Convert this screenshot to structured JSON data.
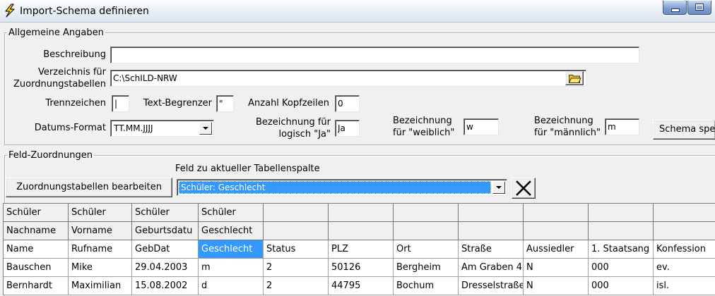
{
  "window": {
    "title": "Import-Schema definieren",
    "icon": "lightning-icon",
    "minimize_icon": "minimize-icon",
    "maximize_icon": "maximize-icon"
  },
  "colors": {
    "window_background": "#f0f0f0",
    "selection": "#3399ff",
    "titlebar_buttons": "#7e9fd0"
  },
  "general": {
    "legend": "Allgemeine Angaben",
    "description": {
      "label": "Beschreibung",
      "value": ""
    },
    "directory": {
      "label_line1": "Verzeichnis für",
      "label_line2": "Zuordnungstabellen",
      "value": "C:\\SchILD-NRW",
      "browse_icon": "folder-icon"
    },
    "separator": {
      "label": "Trennzeichen",
      "value": "|"
    },
    "text_delimiter": {
      "label": "Text-Begrenzer",
      "value": "\""
    },
    "header_rows": {
      "label": "Anzahl Kopfzeilen",
      "value": "0"
    },
    "date_format": {
      "label": "Datums-Format",
      "value": "TT.MM.JJJJ"
    },
    "logical_yes": {
      "label_line1": "Bezeichnung für",
      "label_line2": "logisch \"Ja\"",
      "value": "Ja"
    },
    "female": {
      "label_line1": "Bezeichnung",
      "label_line2": "für \"weiblich\"",
      "value": "w"
    },
    "male": {
      "label_line1": "Bezeichnung",
      "label_line2": "für \"männlich\"",
      "value": "m"
    },
    "save_schema_label": "Schema spe"
  },
  "mapping": {
    "legend": "Feld-Zuordnungen",
    "field_label": "Feld zu aktueller Tabellenspalte",
    "edit_tables_label": "Zuordnungstabellen bearbeiten",
    "field_select_value": "Schüler: Geschlecht",
    "clear_icon": "x-icon"
  },
  "grid": {
    "header_rows": [
      [
        "Schüler",
        "Schüler",
        "Schüler",
        "Schüler"
      ],
      [
        "Nachname",
        "Vorname",
        "Geburtsdatu",
        "Geschlecht"
      ]
    ],
    "rows": [
      [
        "Name",
        "Rufname",
        "GebDat",
        "Geschlecht",
        "Status",
        "PLZ",
        "Ort",
        "Straße",
        "Aussiedler",
        "1. Staatsang",
        "Konfession"
      ],
      [
        "Bauschen",
        "Mike",
        "29.04.2003",
        "m",
        "2",
        "50126",
        "Bergheim",
        "Am Graben 4",
        "N",
        "000",
        "ev."
      ],
      [
        "Bernhardt",
        "Maximilian",
        "15.08.2002",
        "d",
        "2",
        "44795",
        "Bochum",
        "Dresselstraße",
        "N",
        "000",
        "isl."
      ]
    ]
  }
}
